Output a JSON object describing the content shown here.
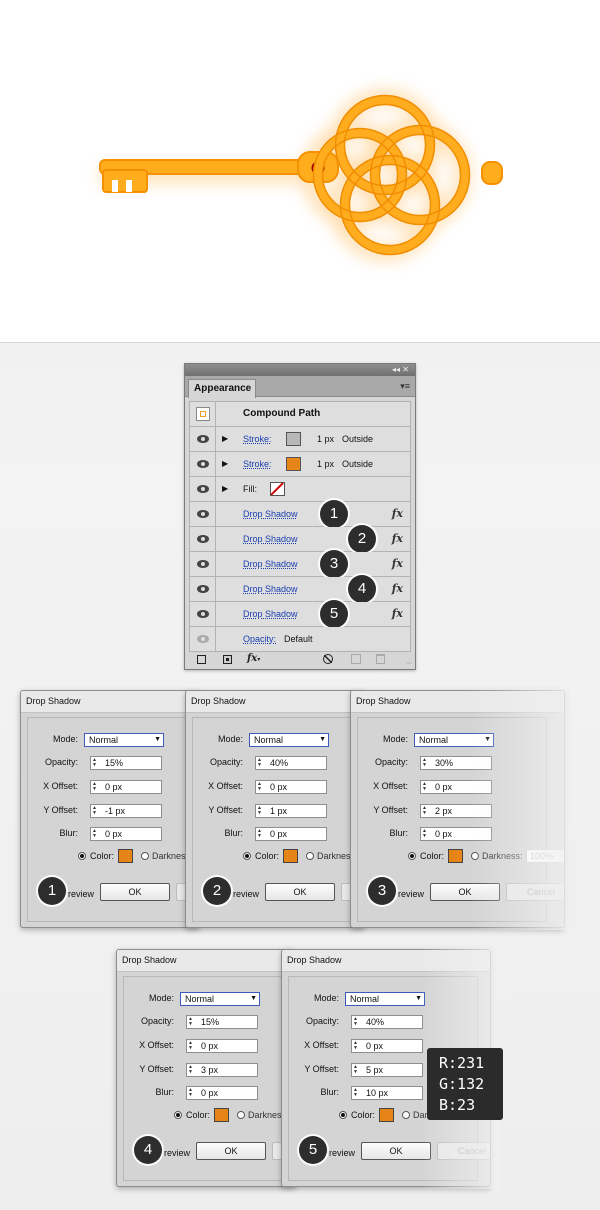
{
  "panel": {
    "title_controls": "◂◂  ✕",
    "tab": "Appearance",
    "menu_icon": "▾≡",
    "object_type": "Compound Path",
    "rows": [
      {
        "kind": "stroke",
        "label": "Stroke:",
        "swatch": "#9a9a9a",
        "weight": "1 px",
        "position": "Outside"
      },
      {
        "kind": "stroke",
        "label": "Stroke:",
        "swatch": "#e78417",
        "weight": "1 px",
        "position": "Outside"
      },
      {
        "kind": "fill",
        "label": "Fill:",
        "swatch": "none"
      },
      {
        "kind": "effect",
        "label": "Drop Shadow",
        "badge": "1"
      },
      {
        "kind": "effect",
        "label": "Drop Shadow",
        "badge": "2"
      },
      {
        "kind": "effect",
        "label": "Drop Shadow",
        "badge": "3"
      },
      {
        "kind": "effect",
        "label": "Drop Shadow",
        "badge": "4"
      },
      {
        "kind": "effect",
        "label": "Drop Shadow",
        "badge": "5"
      }
    ],
    "opacity_label": "Opacity:",
    "opacity_value": "Default",
    "fx_glyph": "fx"
  },
  "dialog_labels": {
    "title": "Drop Shadow",
    "mode": "Mode:",
    "opacity": "Opacity:",
    "x_offset": "X Offset:",
    "y_offset": "Y Offset:",
    "blur": "Blur:",
    "color": "Color:",
    "darkness": "Darkness:",
    "preview": "Preview",
    "ok": "OK",
    "cancel": "Cancel"
  },
  "dialogs": [
    {
      "badge": "1",
      "mode": "Normal",
      "opacity": "15%",
      "x_offset": "0 px",
      "y_offset": "-1 px",
      "blur": "0 px",
      "color": "#e78417"
    },
    {
      "badge": "2",
      "mode": "Normal",
      "opacity": "40%",
      "x_offset": "0 px",
      "y_offset": "1 px",
      "blur": "0 px",
      "color": "#e78417"
    },
    {
      "badge": "3",
      "mode": "Normal",
      "opacity": "30%",
      "x_offset": "0 px",
      "y_offset": "2 px",
      "blur": "0 px",
      "color": "#e78417",
      "darkness_value": "100%"
    },
    {
      "badge": "4",
      "mode": "Normal",
      "opacity": "15%",
      "x_offset": "0 px",
      "y_offset": "3 px",
      "blur": "0 px",
      "color": "#e78417"
    },
    {
      "badge": "5",
      "mode": "Normal",
      "opacity": "40%",
      "x_offset": "0 px",
      "y_offset": "5 px",
      "blur": "10 px",
      "color": "#e78417"
    }
  ],
  "rgb": {
    "r": "R:231",
    "g": "G:132",
    "b": "B:23"
  },
  "colors": {
    "key_orange": "#ffab1c",
    "key_dark": "#f09000",
    "gem": "#d01010"
  }
}
